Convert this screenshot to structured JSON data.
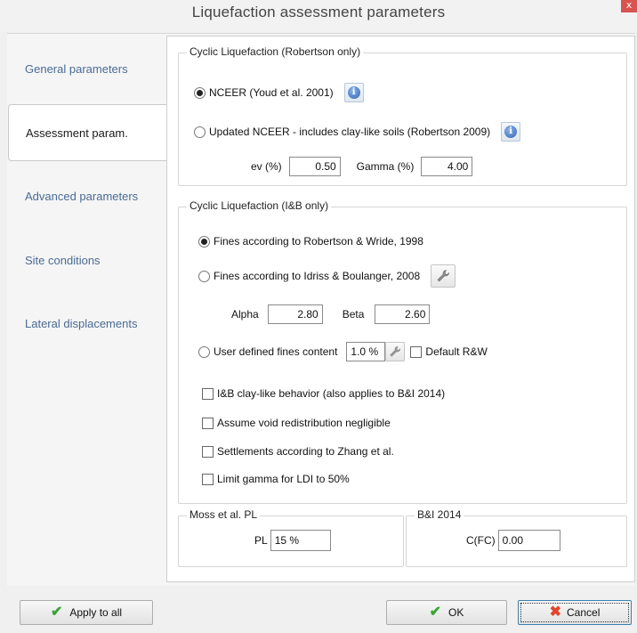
{
  "window": {
    "title": "Liquefaction assessment parameters",
    "close_glyph": "x"
  },
  "nav": {
    "items": [
      {
        "label": "General parameters",
        "active": false
      },
      {
        "label": "Assessment param.",
        "active": true
      },
      {
        "label": "Advanced parameters",
        "active": false
      },
      {
        "label": "Site conditions",
        "active": false
      },
      {
        "label": "Lateral displacements",
        "active": false
      }
    ]
  },
  "robertson": {
    "legend": "Cyclic Liquefaction (Robertson only)",
    "opt_ncEER": "NCEER (Youd et al. 2001)",
    "opt_updated": "Updated NCEER - includes clay-like soils (Robertson 2009)",
    "ev_label": "ev (%)",
    "ev_value": "0.50",
    "gamma_label": "Gamma (%)",
    "gamma_value": "4.00"
  },
  "ib": {
    "legend": "Cyclic Liquefaction (I&B only)",
    "opt_rw": "Fines according to Robertson & Wride, 1998",
    "opt_ib": "Fines according to Idriss & Boulanger, 2008",
    "alpha_label": "Alpha",
    "alpha_value": "2.80",
    "beta_label": "Beta",
    "beta_value": "2.60",
    "opt_user": "User defined fines content",
    "fines_value": "1.0 %",
    "default_rw": "Default R&W",
    "chk_clay": "I&B clay-like behavior (also applies to B&I 2014)",
    "chk_void": "Assume void redistribution negligible",
    "chk_zhang": "Settlements according to Zhang et al.",
    "chk_ldi": "Limit gamma for LDI to 50%"
  },
  "moss": {
    "legend": "Moss et al. PL",
    "pl_label": "PL",
    "pl_value": "15 %"
  },
  "bi": {
    "legend": "B&I 2014",
    "cfc_label": "C(FC)",
    "cfc_value": "0.00"
  },
  "buttons": {
    "apply_all": "Apply to all",
    "ok": "OK",
    "cancel": "Cancel"
  },
  "icons": {
    "info": "info-icon",
    "wrench": "wrench-icon",
    "check": "checkmark-icon",
    "cancel": "x-cross-icon"
  },
  "colors": {
    "nav_link": "#4a6b94",
    "ok_check": "#3aa635",
    "cancel_x": "#e0452c",
    "close": "#d9534f"
  }
}
